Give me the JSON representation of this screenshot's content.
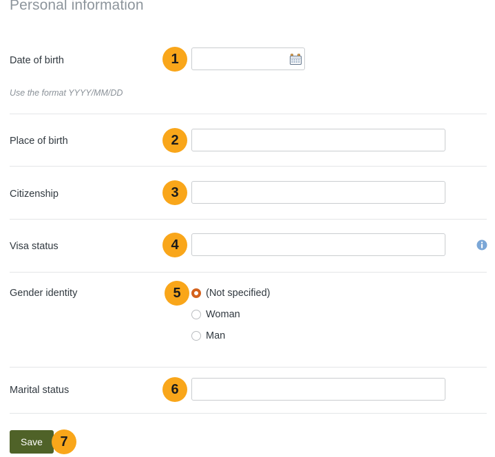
{
  "section": {
    "title": "Personal information"
  },
  "fields": {
    "date_of_birth": {
      "label": "Date of birth",
      "value": "",
      "placeholder": "",
      "hint": "Use the format YYYY/MM/DD",
      "icon": "calendar-icon",
      "badge": "1"
    },
    "place_of_birth": {
      "label": "Place of birth",
      "value": "",
      "placeholder": "",
      "badge": "2"
    },
    "citizenship": {
      "label": "Citizenship",
      "value": "",
      "placeholder": "",
      "badge": "3"
    },
    "visa_status": {
      "label": "Visa status",
      "value": "",
      "placeholder": "",
      "icon": "info-icon",
      "badge": "4"
    },
    "gender_identity": {
      "label": "Gender identity",
      "badge": "5",
      "selected": "(Not specified)",
      "options": [
        {
          "label": "(Not specified)",
          "checked": true
        },
        {
          "label": "Woman",
          "checked": false
        },
        {
          "label": "Man",
          "checked": false
        }
      ]
    },
    "marital_status": {
      "label": "Marital status",
      "value": "",
      "placeholder": "",
      "badge": "6"
    }
  },
  "actions": {
    "save_label": "Save",
    "save_badge": "7"
  },
  "colors": {
    "badge": "#f9a61a",
    "save_button": "#4f6228",
    "radio_selected": "#d4621d",
    "info_icon": "#7ba7d7",
    "separator": "#e3e5e7",
    "label_text": "#30383f",
    "heading_text": "#8d959c",
    "hint_text": "#8a9198"
  }
}
